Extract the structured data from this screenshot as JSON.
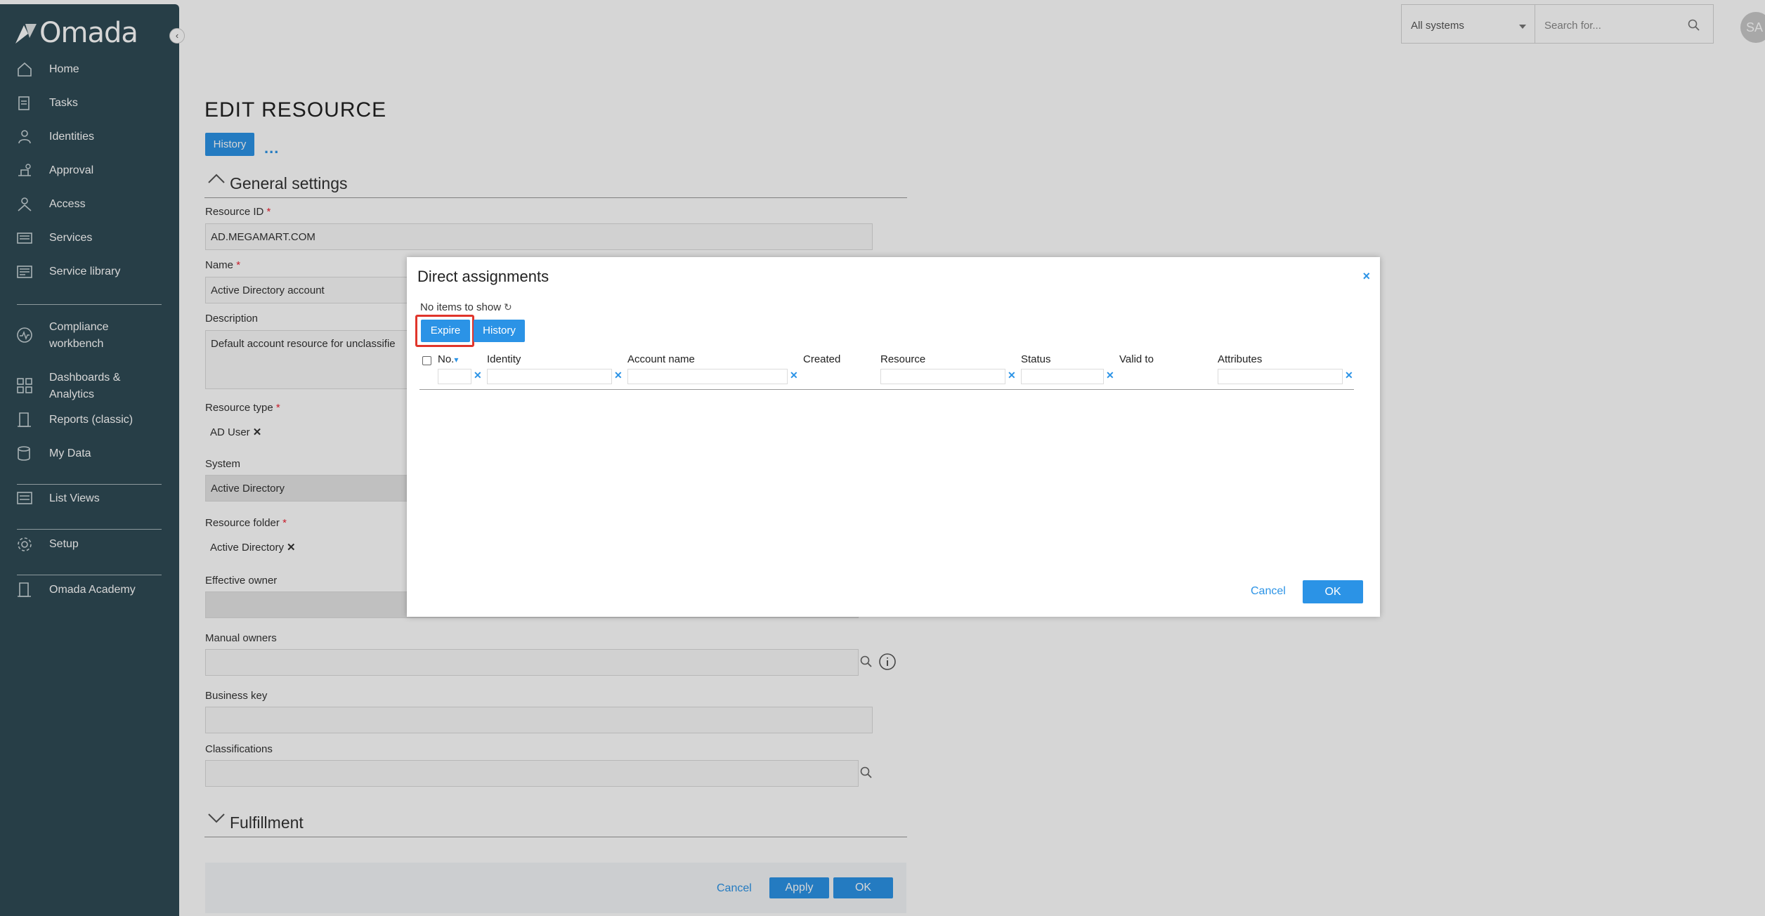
{
  "app": {
    "brand": "Omada"
  },
  "sidebar": {
    "items": [
      {
        "label": "Home",
        "icon": "home-icon"
      },
      {
        "label": "Tasks",
        "icon": "tasks-icon"
      },
      {
        "label": "Identities",
        "icon": "identities-icon"
      },
      {
        "label": "Approval",
        "icon": "approval-icon"
      },
      {
        "label": "Access",
        "icon": "access-icon"
      },
      {
        "label": "Services",
        "icon": "services-icon"
      },
      {
        "label": "Service library",
        "icon": "service-library-icon"
      },
      {
        "label_line1": "Compliance",
        "label_line2": "workbench",
        "icon": "compliance-icon"
      },
      {
        "label_line1": "Dashboards &",
        "label_line2": "Analytics",
        "icon": "dashboards-icon"
      },
      {
        "label": "Reports (classic)",
        "icon": "reports-icon"
      },
      {
        "label": "My Data",
        "icon": "my-data-icon"
      },
      {
        "label": "List Views",
        "icon": "list-views-icon"
      },
      {
        "label": "Setup",
        "icon": "setup-icon"
      },
      {
        "label": "Omada Academy",
        "icon": "academy-icon"
      }
    ]
  },
  "topbar": {
    "system_selected": "All systems",
    "search_placeholder": "Search for...",
    "avatar_initials": "SA"
  },
  "page": {
    "title": "EDIT RESOURCE",
    "history_tab": "History",
    "more": "...",
    "general_settings": "General settings",
    "fulfillment": "Fulfillment",
    "fields": {
      "resource_id_label": "Resource ID",
      "resource_id_value": "AD.MEGAMART.COM",
      "name_label": "Name",
      "name_value": "Active Directory account",
      "description_label": "Description",
      "description_value": "Default account resource for unclassifie",
      "resource_type_label": "Resource type",
      "resource_type_value": "AD User",
      "system_label": "System",
      "system_value": "Active Directory",
      "resource_folder_label": "Resource folder",
      "resource_folder_value": "Active Directory",
      "effective_owner_label": "Effective owner",
      "manual_owners_label": "Manual owners",
      "business_key_label": "Business key",
      "classifications_label": "Classifications",
      "required_mark": "*"
    },
    "footer": {
      "cancel": "Cancel",
      "apply": "Apply",
      "ok": "OK"
    }
  },
  "modal": {
    "title": "Direct assignments",
    "close": "×",
    "no_items": "No items to show",
    "refresh_glyph": "↻",
    "expire": "Expire",
    "history": "History",
    "columns": [
      "No.",
      "Identity",
      "Account name",
      "Created",
      "Resource",
      "Status",
      "Valid to",
      "Attributes"
    ],
    "sort_glyph": "▾",
    "cancel": "Cancel",
    "ok": "OK"
  },
  "colors": {
    "accent": "#2b93e6",
    "sidebar": "#2f4a55",
    "highlight": "#e0352b"
  }
}
